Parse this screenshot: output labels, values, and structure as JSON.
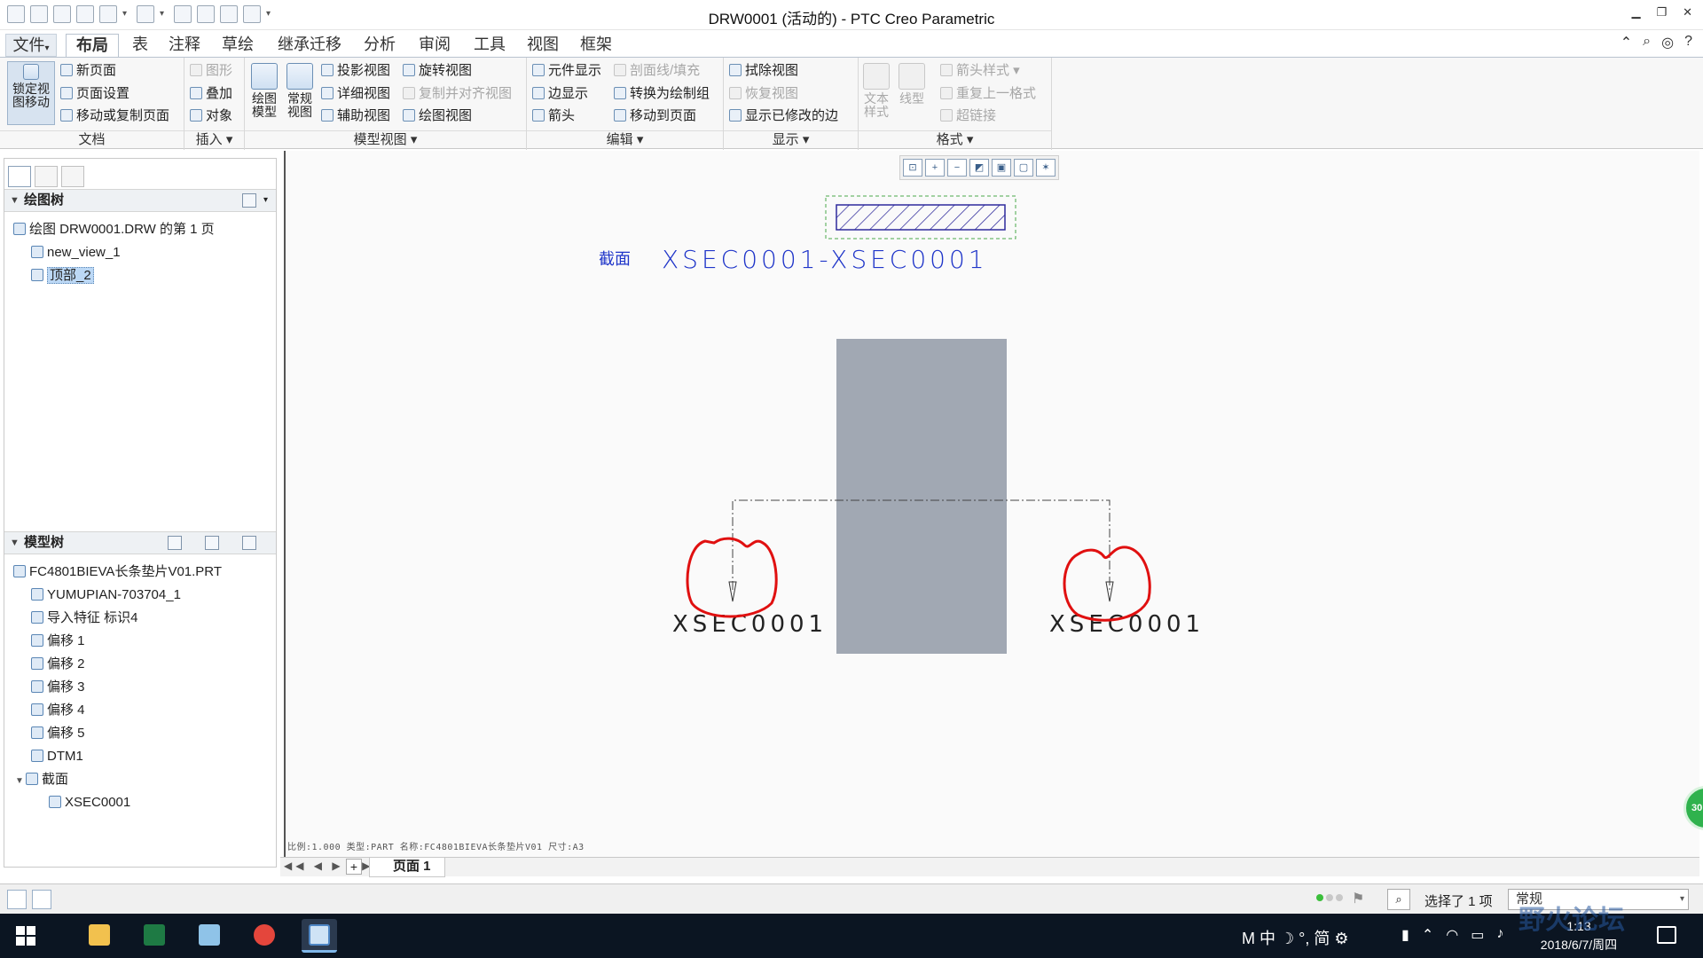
{
  "window": {
    "title": "DRW0001 (活动的) - PTC Creo Parametric"
  },
  "menu": {
    "tabs": [
      "文件",
      "布局",
      "表",
      "注释",
      "草绘",
      "继承迁移",
      "分析",
      "审阅",
      "工具",
      "视图",
      "框架"
    ],
    "active_tab": "布局"
  },
  "ribbon": {
    "groups": {
      "document": "文档",
      "insert": "插入",
      "model_views": "模型视图",
      "edit": "编辑",
      "display": "显示",
      "format": "格式"
    },
    "lock_view_label": "锁定视图移动",
    "new_page": "新页面",
    "page_setup": "页面设置",
    "move_copy_page": "移动或复制页面",
    "graphic": "图形",
    "overlay": "叠加",
    "object": "对象",
    "draw_model": "绘图模型",
    "general_view": "常规视图",
    "projection_view": "投影视图",
    "detail_view": "详细视图",
    "auxiliary_view": "辅助视图",
    "revolve_view": "旋转视图",
    "copy_align_view": "复制并对齐视图",
    "drawing_view": "绘图视图",
    "component_display": "元件显示",
    "edge_display": "边显示",
    "arrow": "箭头",
    "section_line_fill": "剖面线/填充",
    "convert_to_draft_group": "转换为绘制组",
    "move_to_page": "移动到页面",
    "erase_view": "拭除视图",
    "resume_view": "恢复视图",
    "show_modified_edges": "显示已修改的边",
    "text_style": "文本样式",
    "line_style": "线型",
    "arrow_style": "箭头样式",
    "repeat_last_format": "重复上一格式",
    "hyperlink": "超链接"
  },
  "drawing_tree": {
    "header": "绘图树",
    "items": [
      {
        "label": "绘图 DRW0001.DRW 的第 1 页"
      },
      {
        "label": "new_view_1"
      },
      {
        "label": "顶部_2"
      }
    ]
  },
  "model_tree": {
    "header": "模型树",
    "items": [
      {
        "label": "FC4801BIEVA长条垫片V01.PRT"
      },
      {
        "label": "YUMUPIAN-703704_1"
      },
      {
        "label": "导入特征 标识4"
      },
      {
        "label": "偏移 1"
      },
      {
        "label": "偏移 2"
      },
      {
        "label": "偏移 3"
      },
      {
        "label": "偏移 4"
      },
      {
        "label": "偏移 5"
      },
      {
        "label": "DTM1"
      },
      {
        "label": "截面"
      },
      {
        "label": "XSEC0001"
      }
    ]
  },
  "drawing": {
    "section_prefix": "截面",
    "section_title": "XSEC0001-XSEC0001",
    "left_arrow_label": "XSEC0001",
    "right_arrow_label": "XSEC0001",
    "status_strip": "比例:1.000  类型:PART  名称:FC4801BIEVA长条垫片V01  尺寸:A3"
  },
  "page_bar": {
    "nav": "◀◀ ◀ ▶ ▶▶",
    "add": "+",
    "page_tab": "页面 1"
  },
  "status_bar": {
    "selection": "选择了 1 项",
    "filter": "常规"
  },
  "taskbar": {
    "ime": "M 中 ☽ °, 简 ⚙",
    "time": "1:13",
    "date": "2018/6/7/周四"
  },
  "overlay": {
    "badge": "30",
    "watermark": "野火论坛"
  },
  "colors": {
    "annotation_blue": "#1f35c9",
    "highlight_red": "#e01010",
    "part_fill": "#a1a8b3",
    "hatch_blue": "#2e2a9c"
  }
}
